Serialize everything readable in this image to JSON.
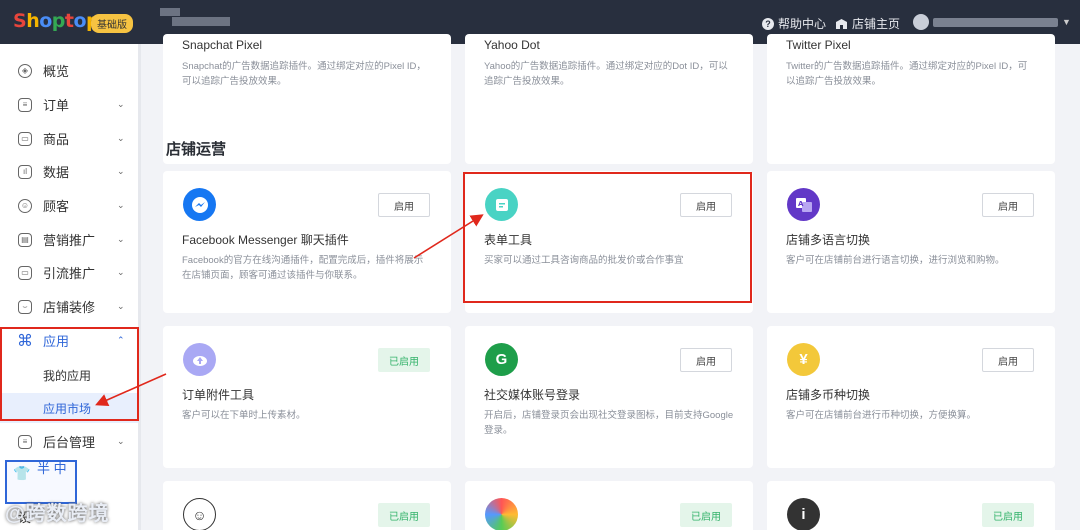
{
  "topbar": {
    "logo": "Shoptop",
    "version_badge": "基础版",
    "help": "帮助中心",
    "store_home": "店铺主页"
  },
  "sidebar": {
    "items": [
      {
        "label": "概览",
        "icon": "compass-icon",
        "caret": ""
      },
      {
        "label": "订单",
        "icon": "order-icon",
        "caret": "⌄"
      },
      {
        "label": "商品",
        "icon": "product-icon",
        "caret": "⌄"
      },
      {
        "label": "数据",
        "icon": "data-icon",
        "caret": "⌄"
      },
      {
        "label": "顾客",
        "icon": "customer-icon",
        "caret": "⌄"
      },
      {
        "label": "营销推广",
        "icon": "marketing-icon",
        "caret": "⌄"
      },
      {
        "label": "引流推广",
        "icon": "traffic-icon",
        "caret": "⌄"
      },
      {
        "label": "店铺装修",
        "icon": "decoration-icon",
        "caret": "⌄"
      },
      {
        "label": "应用",
        "icon": "apps-icon",
        "caret": "⌃"
      }
    ],
    "sub_items": [
      "我的应用",
      "应用市场"
    ],
    "after_items": [
      {
        "label": "后台管理",
        "icon": "admin-icon",
        "caret": "⌄"
      }
    ],
    "settings_label": "设"
  },
  "watermark": {
    "text": "半 中",
    "overlay": "@跨数跨境"
  },
  "top_cards": [
    {
      "name": "Snapchat Pixel",
      "desc": "Snapchat的广告数据追踪插件。通过绑定对应的Pixel ID，可以追踪广告投放效果。"
    },
    {
      "name": "Yahoo Dot",
      "desc": "Yahoo的广告数据追踪插件。通过绑定对应的Dot ID，可以追踪广告投放效果。"
    },
    {
      "name": "Twitter Pixel",
      "desc": "Twitter的广告数据追踪插件。通过绑定对应的Pixel ID，可以追踪广告投放效果。"
    }
  ],
  "section_title": "店铺运营",
  "cards": [
    {
      "name": "Facebook Messenger 聊天插件",
      "desc": "Facebook的官方在线沟通插件，配置完成后，插件将展示在店铺页面，顾客可通过该插件与你联系。",
      "button": "启用",
      "enabled": false,
      "icon": "messenger-icon",
      "color": "#1677f2"
    },
    {
      "name": "表单工具",
      "desc": "买家可以通过工具咨询商品的批发价或合作事宜",
      "button": "启用",
      "enabled": false,
      "icon": "form-icon",
      "color": "#49d3c4"
    },
    {
      "name": "店铺多语言切换",
      "desc": "客户可在店铺前台进行语言切换，进行浏览和购物。",
      "button": "启用",
      "enabled": false,
      "icon": "language-icon",
      "color": "#6238c7"
    },
    {
      "name": "订单附件工具",
      "desc": "客户可以在下单时上传素材。",
      "button": "已启用",
      "enabled": true,
      "icon": "upload-cloud-icon",
      "color": "#a9a8f4"
    },
    {
      "name": "社交媒体账号登录",
      "desc": "开启后，店铺登录页会出现社交登录图标，目前支持Google登录。",
      "button": "启用",
      "enabled": false,
      "icon": "google-icon",
      "color": "#1e9e4a"
    },
    {
      "name": "店铺多币种切换",
      "desc": "客户可在店铺前台进行币种切换，方便换算。",
      "button": "启用",
      "enabled": false,
      "icon": "currency-icon",
      "color": "#f3c83a"
    }
  ],
  "bottom_cards": [
    {
      "button": "已启用",
      "icon": "mailchimp-icon"
    },
    {
      "button": "已启用",
      "icon": "palette-icon"
    },
    {
      "button": "已启用",
      "icon": "info-icon"
    }
  ],
  "colors": {
    "accent": "#2f66d8",
    "highlight": "#e0281c",
    "enabled_bg": "#e4f5ea",
    "enabled_text": "#34b36b",
    "topbar": "#282f3e"
  }
}
